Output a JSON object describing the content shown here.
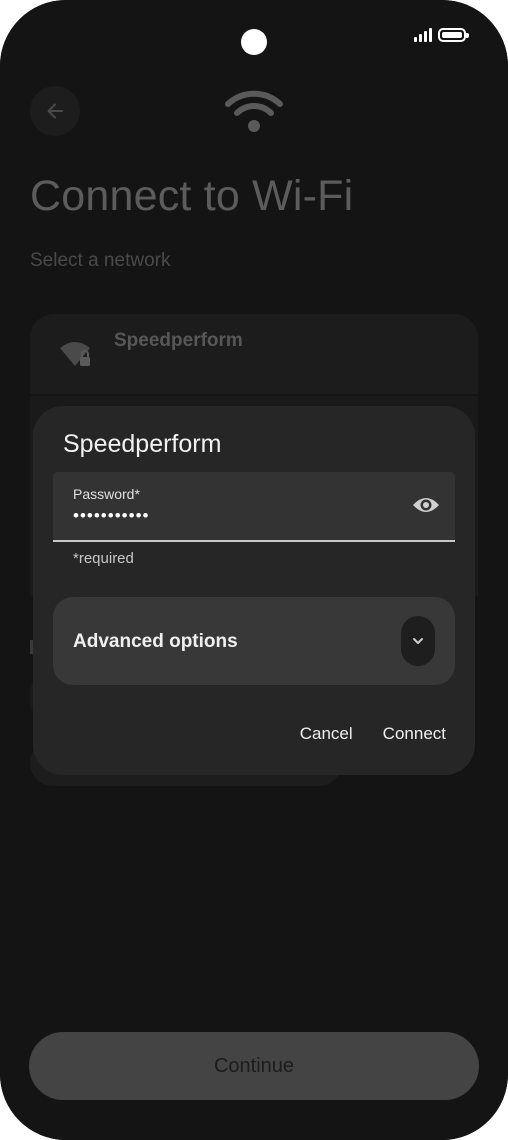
{
  "status_bar": {
    "icons": [
      "signal-icon",
      "battery-icon"
    ]
  },
  "header": {
    "back_icon": "arrow-left-icon",
    "wifi_icon": "wifi-icon",
    "title": "Connect to Wi-Fi",
    "subtitle": "Select a network"
  },
  "network_list": {
    "items": [
      {
        "name": "Speedperform",
        "icon": "wifi-lock-icon"
      }
    ]
  },
  "dialog": {
    "title": "Speedperform",
    "password": {
      "label": "Password*",
      "value": "•••••••••••",
      "helper": "*required",
      "toggle_icon": "eye-icon"
    },
    "advanced": {
      "label": "Advanced options",
      "icon": "chevron-down-icon"
    },
    "cancel_label": "Cancel",
    "connect_label": "Connect"
  },
  "footer": {
    "continue_label": "Continue"
  },
  "colors": {
    "background": "#141414",
    "dialog": "#262626",
    "field": "#333333",
    "button": "#444444"
  }
}
